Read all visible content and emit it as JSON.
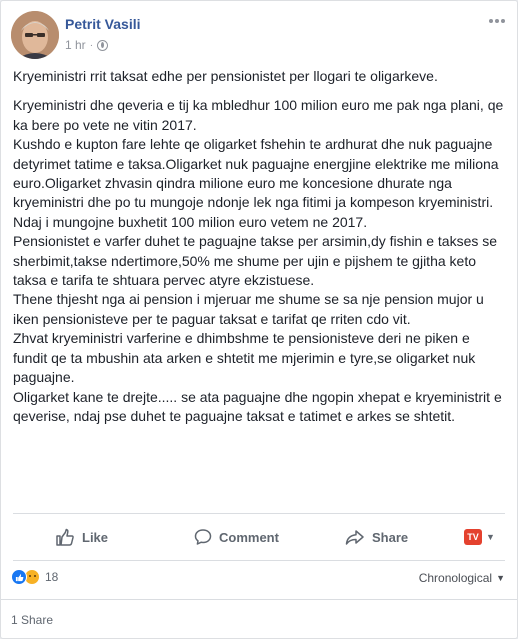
{
  "post": {
    "author": "Petrit Vasili",
    "time": "1 hr",
    "separator": "·",
    "paragraphs": [
      "Kryeministri rrit taksat edhe per pensionistet per llogari te oligarkeve.",
      "Kryeministri dhe qeveria e tij ka mbledhur 100 milion euro me pak nga plani, qe ka bere po vete ne vitin 2017.\nKushdo e kupton fare lehte qe oligarket fshehin te ardhurat dhe nuk paguajne detyrimet tatime e taksa.Oligarket nuk paguajne energjine elektrike me miliona euro.Oligarket zhvasin qindra milione euro me koncesione dhurate nga kryeministri dhe po tu mungoje ndonje lek nga fitimi ja kompeson kryeministri.\nNdaj i mungojne buxhetit 100 milion euro vetem ne 2017.\nPensionistet e varfer duhet te paguajne takse per arsimin,dy fishin e takses se sherbimit,takse ndertimore,50% me shume per ujin e pijshem te gjitha keto taksa e tarifa te shtuara pervec atyre ekzistuese.\nThene thjesht nga ai pension i mjeruar me shume se sa nje pension mujor u iken pensionisteve per te paguar taksat e tarifat qe rriten cdo vit.\nZhvat kryeministri varferine e dhimbshme te pensionisteve deri ne piken e fundit qe ta mbushin ata arken e shtetit me mjerimin e tyre,se oligarket nuk paguajne.\nOligarket kane te drejte..... se ata paguajne dhe ngopin xhepat e kryeministrit e qeverise, ndaj pse duhet te paguajne taksat e tatimet e arkes se shtetit."
    ]
  },
  "actions": {
    "like": "Like",
    "comment": "Comment",
    "share": "Share",
    "tv_badge": "TV"
  },
  "footer": {
    "reaction_count": "18",
    "sort_label": "Chronological",
    "shares": "1 Share"
  },
  "icons": [
    "globe-icon",
    "more-icon",
    "like-icon",
    "comment-icon",
    "share-icon",
    "tv-icon",
    "chevron-down-icon",
    "like-reaction-icon",
    "sad-reaction-icon"
  ],
  "colors": {
    "author": "#365899",
    "meta": "#90949c",
    "action": "#606770",
    "like_reaction": "#1877f2",
    "sad_reaction": "#f7b125",
    "tv_badge": "#e4412e"
  }
}
